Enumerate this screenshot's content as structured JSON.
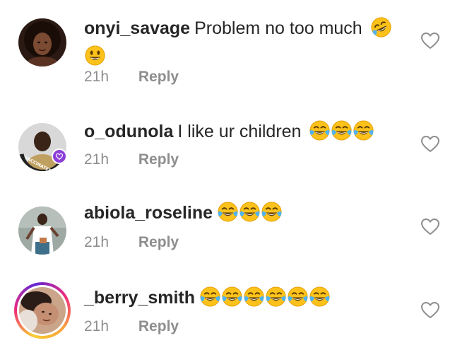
{
  "comments": [
    {
      "username": "onyi_savage",
      "text": "Problem no too much",
      "emojis_inline": [
        "face-with-tears-of-joy"
      ],
      "emojis_second_line": [
        "smiling-face"
      ],
      "time": "21h",
      "reply_label": "Reply",
      "avatar_icon": "profile-photo-woman"
    },
    {
      "username": "o_odunola",
      "text": "I like ur children",
      "emojis_inline": [
        "face-with-tears-of-joy",
        "face-with-tears-of-joy",
        "face-with-tears-of-joy"
      ],
      "time": "21h",
      "reply_label": "Reply",
      "avatar_icon": "profile-photo-vaccinated-frame",
      "avatar_frame_text": "LET'S GET VACCINATED"
    },
    {
      "username": "abiola_roseline",
      "text": "",
      "emojis_inline": [
        "face-with-tears-of-joy",
        "face-with-tears-of-joy",
        "face-with-tears-of-joy"
      ],
      "time": "21h",
      "reply_label": "Reply",
      "avatar_icon": "profile-photo-woman-standing"
    },
    {
      "username": "_berry_smith",
      "text": "",
      "emojis_inline": [
        "face-with-tears-of-joy",
        "face-with-tears-of-joy",
        "face-with-tears-of-joy",
        "face-with-tears-of-joy",
        "face-with-tears-of-joy",
        "face-with-tears-of-joy"
      ],
      "time": "21h",
      "reply_label": "Reply",
      "avatar_icon": "profile-photo-story-ring"
    }
  ],
  "colors": {
    "text": "#262626",
    "meta": "#8e8e8e",
    "heart_outline": "#8e8e8e",
    "emoji_face": "#fcc21b",
    "emoji_tears": "#4fb3f0"
  }
}
